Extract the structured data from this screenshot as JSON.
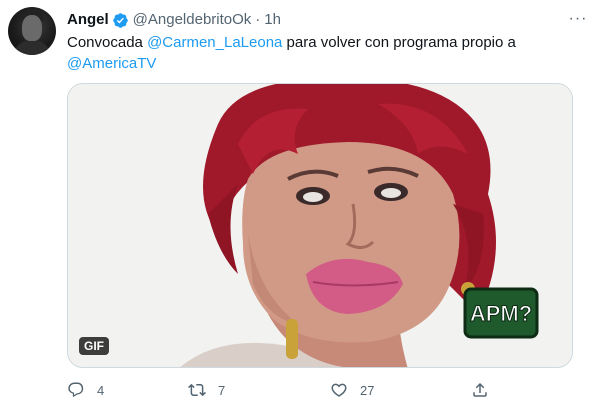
{
  "tweet": {
    "author_name": "Angel",
    "author_handle": "@AngeldebritoOk",
    "separator": "·",
    "time": "1h",
    "more_label": "···",
    "text_parts": {
      "part1": "Convocada ",
      "mention1": "@Carmen_LaLeona",
      "part2": " para volver con programa propio a ",
      "mention2": "@AmericaTV"
    },
    "media": {
      "badge": "GIF",
      "sign_text": "APM?"
    },
    "actions": {
      "reply_count": "4",
      "retweet_count": "7",
      "like_count": "27",
      "share_count": ""
    }
  },
  "colors": {
    "accent": "#1d9bf0",
    "secondary_text": "#536471",
    "primary_text": "#0f1419",
    "border": "#cfd9de"
  },
  "icons": {
    "verified": "verified-badge-icon",
    "reply": "reply-icon",
    "retweet": "retweet-icon",
    "like": "heart-icon",
    "share": "share-icon",
    "more": "more-icon"
  }
}
